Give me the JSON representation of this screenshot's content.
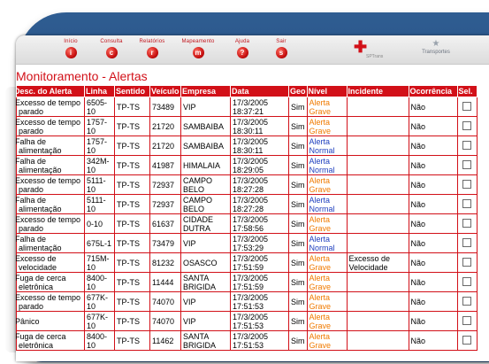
{
  "toolbar": {
    "items": [
      {
        "label": "Início",
        "glyph": "i"
      },
      {
        "label": "Consulta",
        "glyph": "c"
      },
      {
        "label": "Relatórios",
        "glyph": "r"
      },
      {
        "label": "Mapeamento",
        "glyph": "m"
      },
      {
        "label": "Ajuda",
        "glyph": "?"
      },
      {
        "label": "Sair",
        "glyph": "s"
      }
    ],
    "logos": {
      "sptrans": "SPTrans",
      "transportes": "Transportes"
    }
  },
  "page": {
    "title": "Monitoramento - Alertas"
  },
  "colors": {
    "accent": "#d21018",
    "grave": "#f07a00",
    "normal": "#1f3fbf",
    "frame": "#1d426f"
  },
  "table": {
    "headers": [
      "Desc. do Alerta",
      "Linha",
      "Sentido",
      "Veículo",
      "Empresa",
      "Data",
      "Geo",
      "Nível",
      "Incidente",
      "Ocorrência",
      "Sel."
    ],
    "rows": [
      {
        "desc": "Excesso de tempo parado",
        "linha": "6505-10",
        "sentido": "TP-TS",
        "veiculo": "73489",
        "empresa": "VIP",
        "data": "17/3/2005 18:37:21",
        "geo": "Sim",
        "nivel": "Alerta Grave",
        "incidente": "",
        "ocorrencia": "Não"
      },
      {
        "desc": "Excesso de tempo parado",
        "linha": "1757-10",
        "sentido": "TP-TS",
        "veiculo": "21720",
        "empresa": "SAMBAIBA",
        "data": "17/3/2005 18:30:11",
        "geo": "Sim",
        "nivel": "Alerta Grave",
        "incidente": "",
        "ocorrencia": "Não"
      },
      {
        "desc": "Falha de alimentação",
        "linha": "1757-10",
        "sentido": "TP-TS",
        "veiculo": "21720",
        "empresa": "SAMBAIBA",
        "data": "17/3/2005 18:30:11",
        "geo": "Sim",
        "nivel": "Alerta Normal",
        "incidente": "",
        "ocorrencia": "Não"
      },
      {
        "desc": "Falha de alimentação",
        "linha": "342M-10",
        "sentido": "TP-TS",
        "veiculo": "41987",
        "empresa": "HIMALAIA",
        "data": "17/3/2005 18:29:05",
        "geo": "Sim",
        "nivel": "Alerta Normal",
        "incidente": "",
        "ocorrencia": "Não"
      },
      {
        "desc": "Excesso de tempo parado",
        "linha": "5111-10",
        "sentido": "TP-TS",
        "veiculo": "72937",
        "empresa": "CAMPO BELO",
        "data": "17/3/2005 18:27:28",
        "geo": "Sim",
        "nivel": "Alerta Grave",
        "incidente": "",
        "ocorrencia": "Não"
      },
      {
        "desc": "Falha de alimentação",
        "linha": "5111-10",
        "sentido": "TP-TS",
        "veiculo": "72937",
        "empresa": "CAMPO BELO",
        "data": "17/3/2005 18:27:28",
        "geo": "Sim",
        "nivel": "Alerta Normal",
        "incidente": "",
        "ocorrencia": "Não"
      },
      {
        "desc": "Excesso de tempo parado",
        "linha": "0-10",
        "sentido": "TP-TS",
        "veiculo": "61637",
        "empresa": "CIDADE DUTRA",
        "data": "17/3/2005 17:58:56",
        "geo": "Sim",
        "nivel": "Alerta Grave",
        "incidente": "",
        "ocorrencia": "Não"
      },
      {
        "desc": "Falha de alimentação",
        "linha": "675L-1",
        "sentido": "TP-TS",
        "veiculo": "73479",
        "empresa": "VIP",
        "data": "17/3/2005 17:53:29",
        "geo": "Sim",
        "nivel": "Alerta Normal",
        "incidente": "",
        "ocorrencia": "Não"
      },
      {
        "desc": "Excesso de velocidade",
        "linha": "715M-10",
        "sentido": "TP-TS",
        "veiculo": "81232",
        "empresa": "OSASCO",
        "data": "17/3/2005 17:51:59",
        "geo": "Sim",
        "nivel": "Alerta Grave",
        "incidente": "Excesso de Velocidade",
        "ocorrencia": "Não"
      },
      {
        "desc": "Fuga de cerca eletrônica",
        "linha": "8400-10",
        "sentido": "TP-TS",
        "veiculo": "11444",
        "empresa": "SANTA BRIGIDA",
        "data": "17/3/2005 17:51:59",
        "geo": "Sim",
        "nivel": "Alerta Grave",
        "incidente": "",
        "ocorrencia": "Não"
      },
      {
        "desc": "Excesso de tempo parado",
        "linha": "677K-10",
        "sentido": "TP-TS",
        "veiculo": "74070",
        "empresa": "VIP",
        "data": "17/3/2005 17:51:53",
        "geo": "Sim",
        "nivel": "Alerta Grave",
        "incidente": "",
        "ocorrencia": "Não"
      },
      {
        "desc": "Pânico",
        "linha": "677K-10",
        "sentido": "TP-TS",
        "veiculo": "74070",
        "empresa": "VIP",
        "data": "17/3/2005 17:51:53",
        "geo": "Sim",
        "nivel": "Alerta Grave",
        "incidente": "",
        "ocorrencia": "Não"
      },
      {
        "desc": "Fuga de cerca eletrônica",
        "linha": "8400-10",
        "sentido": "TP-TS",
        "veiculo": "11462",
        "empresa": "SANTA BRIGIDA",
        "data": "17/3/2005 17:51:53",
        "geo": "Sim",
        "nivel": "Alerta Grave",
        "incidente": "",
        "ocorrencia": "Não"
      }
    ]
  }
}
